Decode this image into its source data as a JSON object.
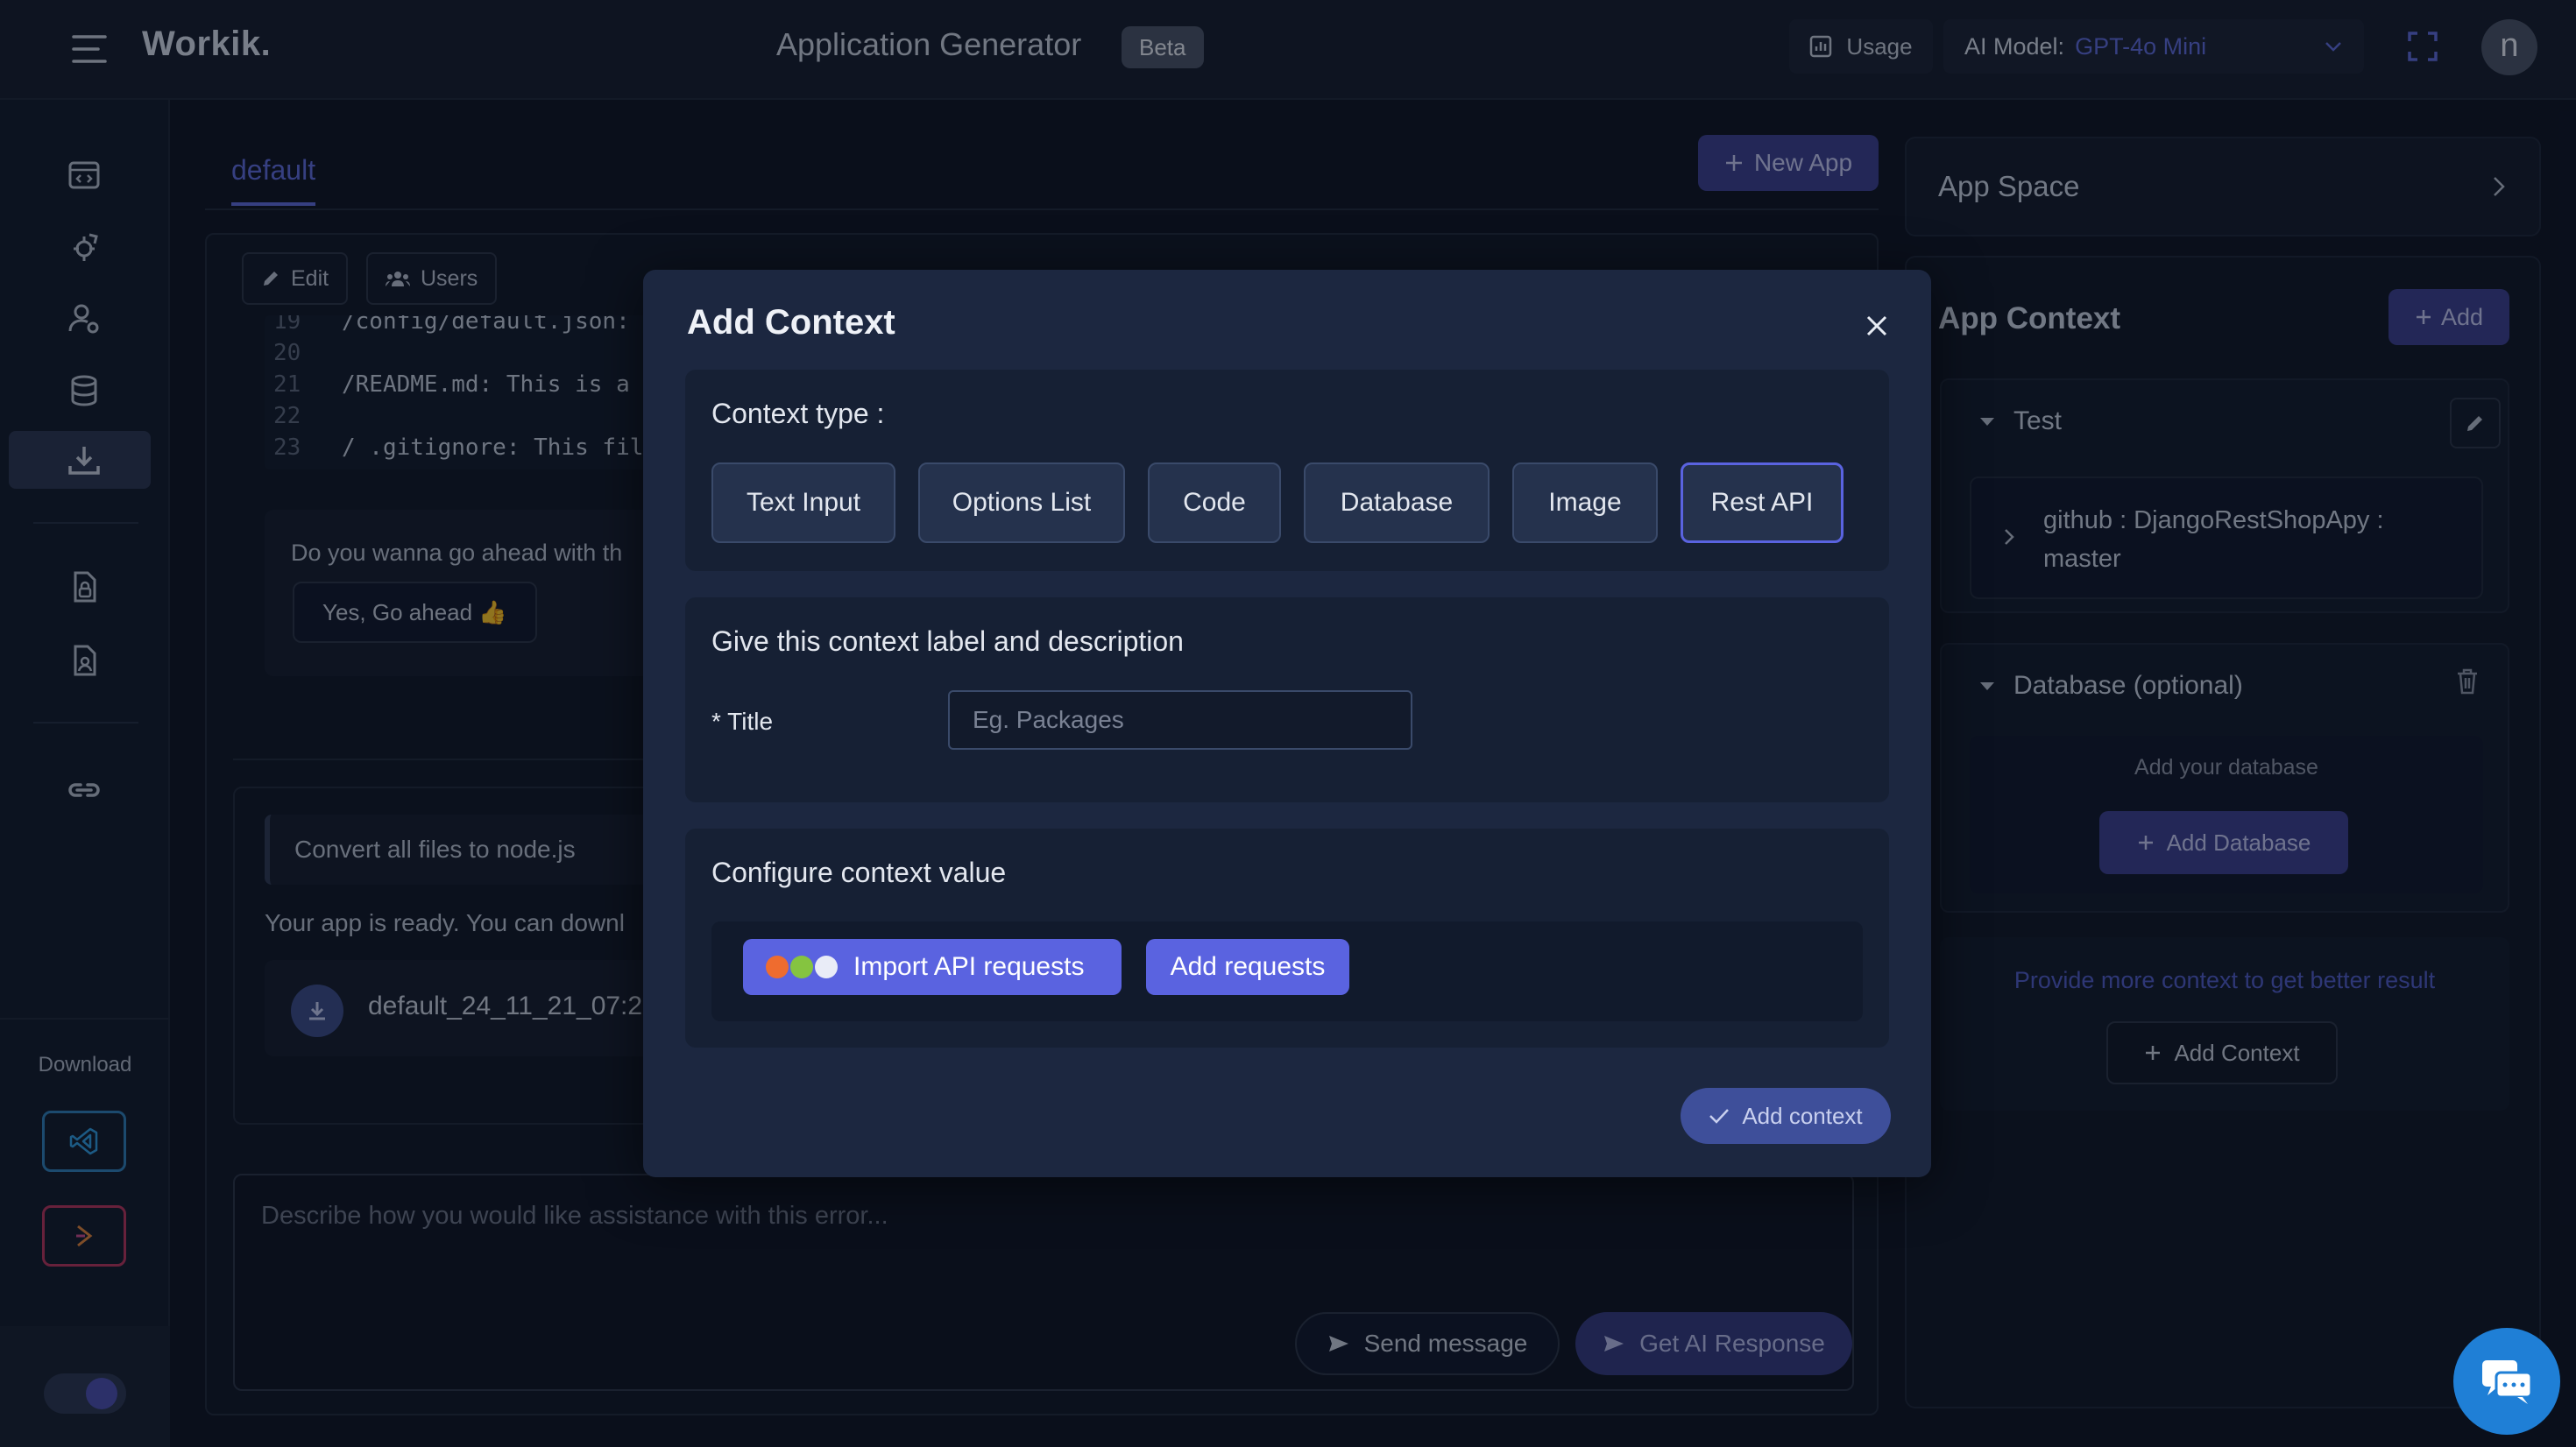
{
  "header": {
    "brand": "Workik.",
    "title": "Application Generator",
    "badge": "Beta",
    "usage_label": "Usage",
    "model_label": "AI Model:",
    "model_value": "GPT-4o Mini",
    "avatar_initial": "n"
  },
  "sidebar": {
    "icons": [
      "code-window-icon",
      "rocket-gear-icon",
      "user-settings-icon",
      "database-icon",
      "download-icon",
      "file-lock-icon",
      "file-user-icon",
      "link-icon"
    ],
    "active_index": 4,
    "download_label": "Download"
  },
  "workspace": {
    "tab": "default",
    "new_app_label": "New App",
    "edit_label": "Edit",
    "users_label": "Users",
    "code_lines": [
      {
        "num": "19",
        "text": "/config/default.json:"
      },
      {
        "num": "20",
        "text": ""
      },
      {
        "num": "21",
        "text": "/README.md: This is a"
      },
      {
        "num": "22",
        "text": ""
      },
      {
        "num": "23",
        "text": "/ .gitignore: This fil"
      }
    ],
    "question": "Do you wanna go ahead with th",
    "yes_label": "Yes, Go ahead 👍",
    "user_message": "Convert all files to node.js",
    "ready_text": "Your app is ready. You can downl",
    "file_name": "default_24_11_21_07:2",
    "prompt_placeholder": "Describe how you would like assistance with this error...",
    "send_label": "Send message",
    "ai_label": "Get AI Response"
  },
  "right": {
    "app_space": "App Space",
    "app_context": "App Context",
    "add_label": "Add",
    "group_test": "Test",
    "repo": "github : DjangoRestShopApy : master",
    "group_db": "Database (optional)",
    "db_hint": "Add your database",
    "add_db_label": "Add Database",
    "more_hint": "Provide more context to get better result",
    "add_context_label": "Add Context"
  },
  "modal": {
    "title": "Add Context",
    "type_label": "Context type :",
    "types": [
      "Text Input",
      "Options List",
      "Code",
      "Database",
      "Image",
      "Rest API"
    ],
    "selected_type": "Rest API",
    "label_section": "Give this context label and description",
    "title_field_label": "* Title",
    "title_placeholder": "Eg. Packages",
    "value_section": "Configure context value",
    "import_label": "Import API requests",
    "add_requests_label": "Add requests",
    "submit_label": "Add context"
  },
  "colors": {
    "accent": "#5a63e0",
    "link": "#5d6bdb",
    "modal_bg": "#1c2740",
    "page_bg": "#0d1322"
  }
}
